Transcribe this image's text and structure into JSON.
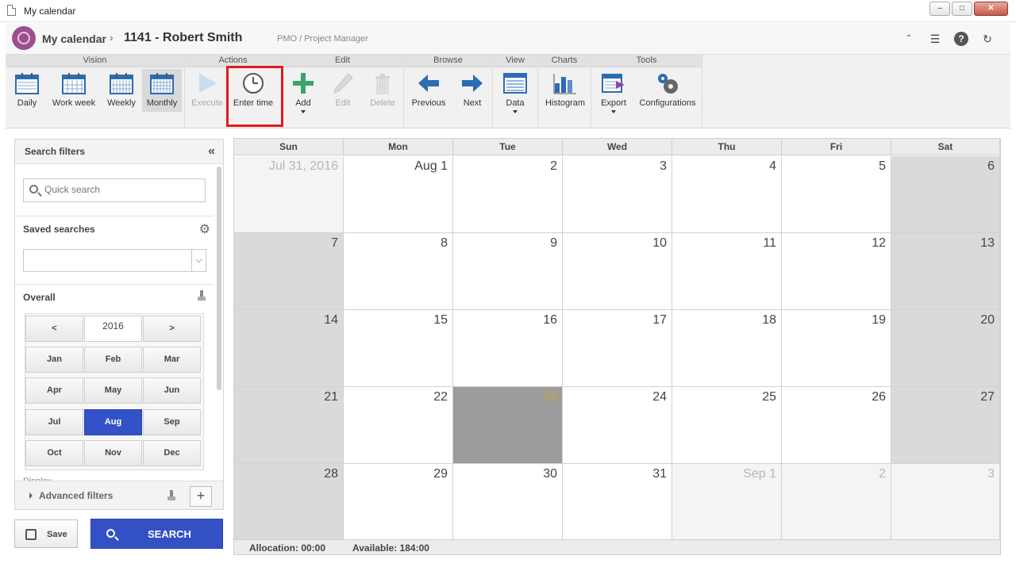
{
  "window": {
    "title": "My calendar",
    "buttons": [
      "–",
      "□",
      "✕"
    ]
  },
  "header": {
    "app": "My calendar",
    "separator": "›",
    "user": "1141 - Robert Smith",
    "role": "PMO / Project Manager",
    "icons": [
      "collapse-up-icon",
      "list-icon",
      "help-icon",
      "refresh-icon"
    ],
    "icon_glyphs": {
      "collapse": "ˆ",
      "list": "☰",
      "help": "?",
      "refresh": "↻"
    }
  },
  "ribbon": {
    "groups": {
      "vision": "Vision",
      "actions": "Actions",
      "edit": "Edit",
      "browse": "Browse",
      "view": "View",
      "charts": "Charts",
      "tools": "Tools"
    },
    "buttons": {
      "daily": "Daily",
      "work_week": "Work week",
      "weekly": "Weekly",
      "monthly": "Monthly",
      "execute": "Execute",
      "enter_time": "Enter time",
      "add": "Add",
      "edit": "Edit",
      "delete": "Delete",
      "previous": "Previous",
      "next": "Next",
      "data": "Data",
      "histogram": "Histogram",
      "export": "Export",
      "configurations": "Configurations"
    },
    "active": "Monthly",
    "highlighted": "Enter time"
  },
  "filters": {
    "title": "Search filters",
    "collapse_glyph": "«",
    "quick_search_placeholder": "Quick search",
    "saved_searches": "Saved searches",
    "saved_value": "",
    "gear_glyph": "⚙",
    "dropdown_glyph": "⌵",
    "overall": "Overall",
    "year_prev": "<",
    "year": "2016",
    "year_next": ">",
    "months": [
      "Jan",
      "Feb",
      "Mar",
      "Apr",
      "May",
      "Jun",
      "Jul",
      "Aug",
      "Sep",
      "Oct",
      "Nov",
      "Dec"
    ],
    "selected_month": "Aug",
    "display_label": "Display",
    "advanced": "Advanced filters",
    "plus_glyph": "+",
    "save": "Save",
    "search": "SEARCH"
  },
  "calendar": {
    "days": [
      "Sun",
      "Mon",
      "Tue",
      "Wed",
      "Thu",
      "Fri",
      "Sat"
    ],
    "weeks": [
      [
        "Jul 31, 2016",
        "Aug 1",
        "2",
        "3",
        "4",
        "5",
        "6"
      ],
      [
        "7",
        "8",
        "9",
        "10",
        "11",
        "12",
        "13"
      ],
      [
        "14",
        "15",
        "16",
        "17",
        "18",
        "19",
        "20"
      ],
      [
        "21",
        "22",
        "23",
        "24",
        "25",
        "26",
        "27"
      ],
      [
        "28",
        "29",
        "30",
        "31",
        "Sep 1",
        "2",
        "3"
      ]
    ],
    "other_month": [
      [
        0,
        0
      ],
      [
        4,
        4
      ],
      [
        4,
        5
      ],
      [
        4,
        6
      ]
    ],
    "today": [
      3,
      2
    ],
    "allocation": "Allocation: 00:00",
    "available": "Available: 184:00"
  }
}
